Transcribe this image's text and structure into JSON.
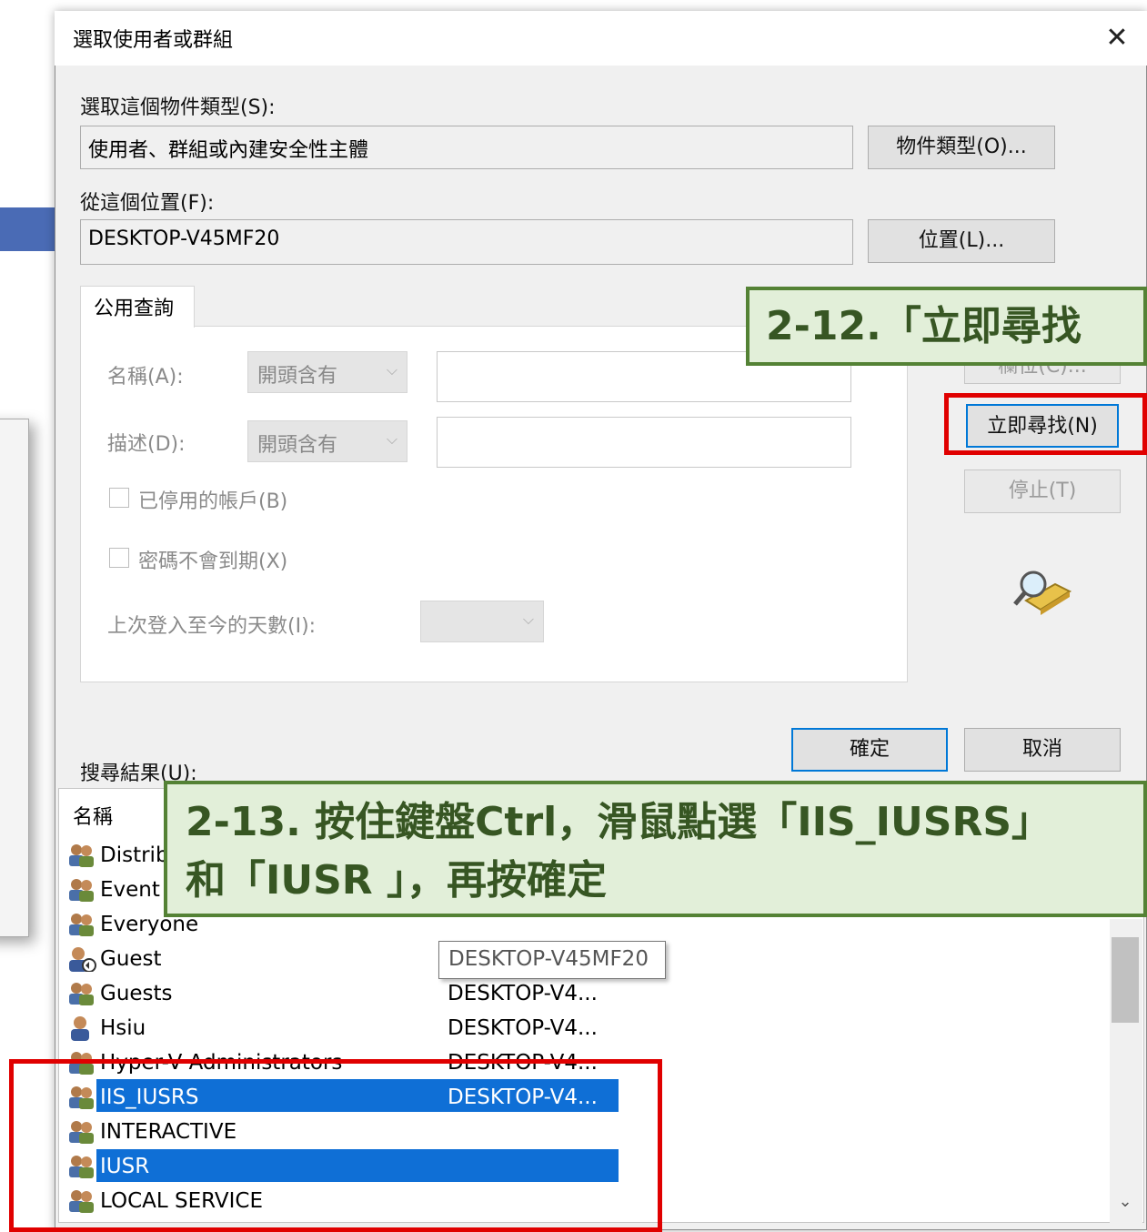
{
  "dialog": {
    "title": "選取使用者或群組",
    "object_type_label": "選取這個物件類型(S):",
    "object_type_value": "使用者、群組或內建安全性主體",
    "object_types_button": "物件類型(O)...",
    "location_label": "從這個位置(F):",
    "location_value": "DESKTOP-V45MF20",
    "location_button": "位置(L)..."
  },
  "query": {
    "tab_label": "公用查詢",
    "name_label": "名稱(A):",
    "name_mode": "開頭含有",
    "desc_label": "描述(D):",
    "desc_mode": "開頭含有",
    "disabled_accounts": "已停用的帳戶(B)",
    "non_expiring_pw": "密碼不會到期(X)",
    "days_since_logon": "上次登入至今的天數(I):",
    "hidden_button_partial": "欄位(C)..."
  },
  "buttons": {
    "find_now": "立即尋找(N)",
    "stop": "停止(T)",
    "ok": "確定",
    "cancel": "取消"
  },
  "results": {
    "label": "搜尋結果(U):",
    "col_name": "名稱",
    "tooltip": "DESKTOP-V45MF20",
    "rows": [
      {
        "name": "Distrib",
        "location": "",
        "icon": "group-icon",
        "selected": false
      },
      {
        "name": "Event",
        "location": "",
        "icon": "group-icon",
        "selected": false
      },
      {
        "name": "Everyone",
        "location": "",
        "icon": "group-icon",
        "selected": false
      },
      {
        "name": "Guest",
        "location": "",
        "icon": "user-disabled-icon",
        "selected": false
      },
      {
        "name": "Guests",
        "location": "DESKTOP-V4...",
        "icon": "group-icon",
        "selected": false
      },
      {
        "name": "Hsiu",
        "location": "DESKTOP-V4...",
        "icon": "user-icon",
        "selected": false
      },
      {
        "name": "Hyper-V Administrators",
        "location": "DESKTOP-V4...",
        "icon": "group-icon",
        "selected": false
      },
      {
        "name": "IIS_IUSRS",
        "location": "DESKTOP-V4...",
        "icon": "group-icon",
        "selected": true
      },
      {
        "name": "INTERACTIVE",
        "location": "",
        "icon": "group-icon",
        "selected": false
      },
      {
        "name": "IUSR",
        "location": "",
        "icon": "group-icon",
        "selected": true
      },
      {
        "name": "LOCAL SERVICE",
        "location": "",
        "icon": "group-icon",
        "selected": false
      }
    ]
  },
  "annotations": {
    "step_12": "2-12.「立即尋找",
    "step_13_line1": "2-13. 按住鍵盤Ctrl，滑鼠點選「IIS_IUSRS」",
    "step_13_line2": "和「IUSR 」，再按確定"
  },
  "colors": {
    "selection": "#0f6fd6",
    "callout_bg": "#e2efd9",
    "callout_border": "#548235",
    "callout_text": "#375623",
    "highlight_red": "#e00000"
  }
}
